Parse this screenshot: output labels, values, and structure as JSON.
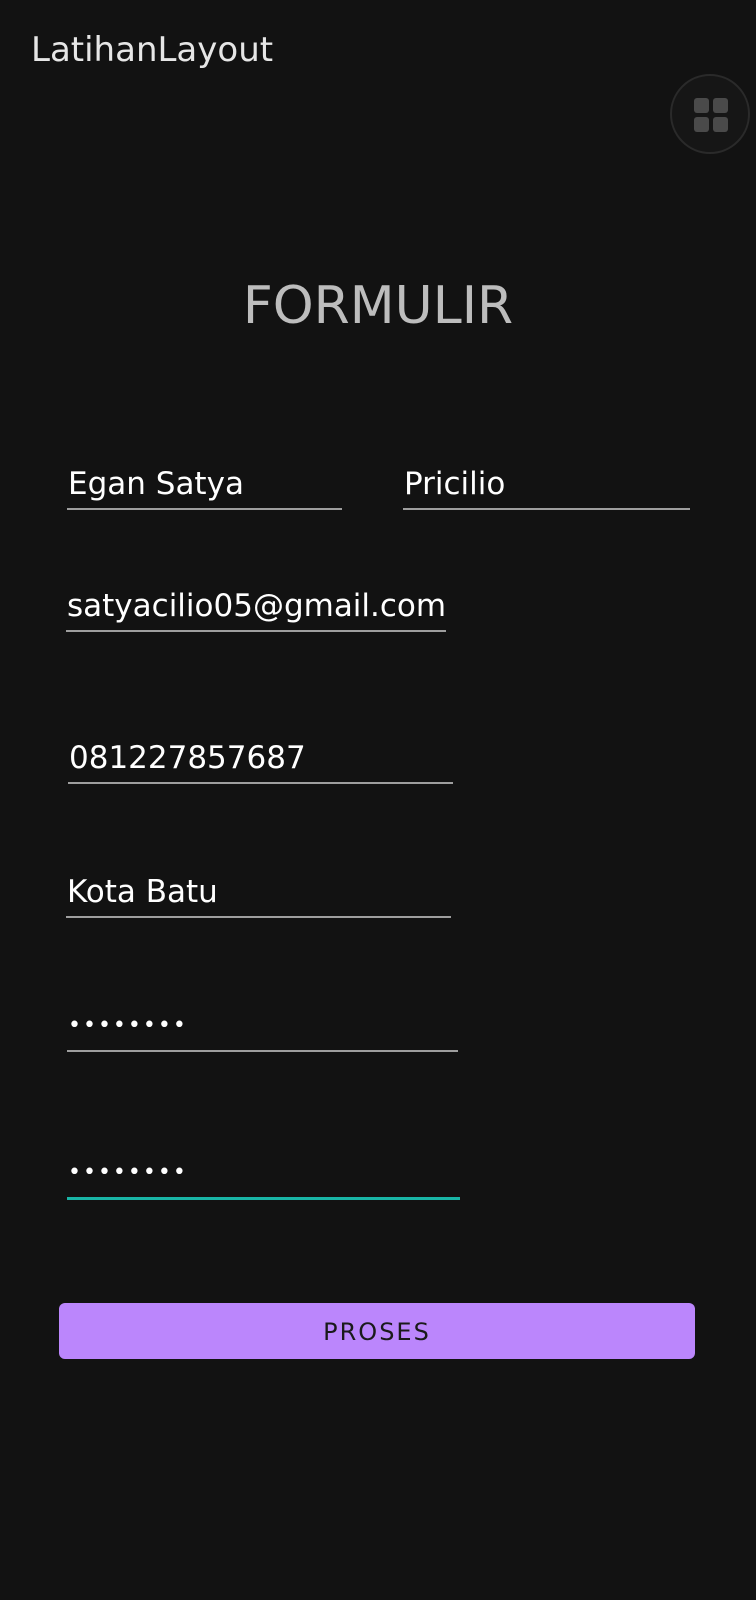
{
  "app_bar": {
    "title": "LatihanLayout"
  },
  "overlay": {
    "icon": "grid-icon"
  },
  "form": {
    "heading": "FORMULIR",
    "first_name": "Egan Satya",
    "last_name": "Pricilio",
    "email": "satyacilio05@gmail.com",
    "phone": "081227857687",
    "city": "Kota Batu",
    "password_mask": "••••••••",
    "confirm_password_mask": "••••••••",
    "submit_label": "PROSES"
  },
  "colors": {
    "background": "#121212",
    "accent": "#bb86fc",
    "focus_underline": "#19b5a6",
    "underline": "#9e9e9e"
  }
}
